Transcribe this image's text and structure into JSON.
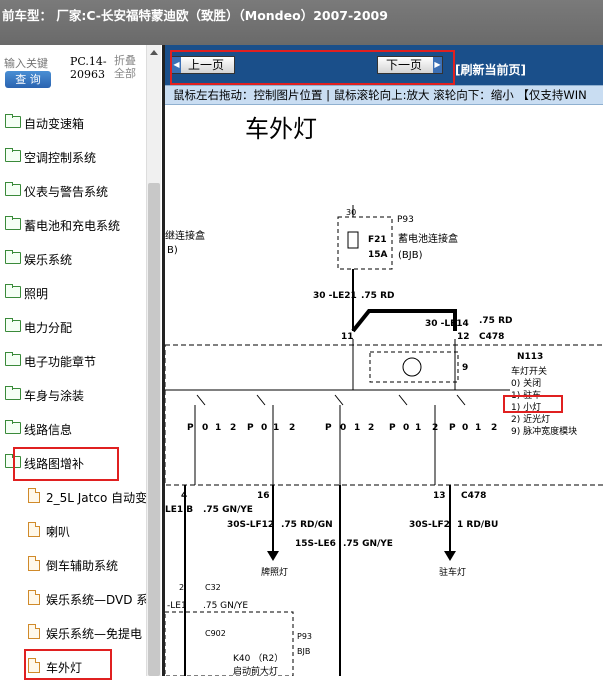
{
  "header": {
    "title": "前车型： 厂家:C-长安福特蒙迪欧（致胜）（Mondeo）2007-2009"
  },
  "search": {
    "placeholder": "输入关键",
    "button": "查 询"
  },
  "pc_code": {
    "line1": "PC.14-",
    "line2": "20963"
  },
  "fold": {
    "line1": "折叠",
    "line2": "全部"
  },
  "tree": {
    "items": [
      {
        "label": "自动变速箱",
        "icon": "folder-icon"
      },
      {
        "label": "空调控制系统",
        "icon": "folder-icon"
      },
      {
        "label": "仪表与警告系统",
        "icon": "folder-icon"
      },
      {
        "label": "蓄电池和充电系统",
        "icon": "folder-icon"
      },
      {
        "label": "娱乐系统",
        "icon": "folder-icon"
      },
      {
        "label": "照明",
        "icon": "folder-icon"
      },
      {
        "label": "电力分配",
        "icon": "folder-icon"
      },
      {
        "label": "电子功能章节",
        "icon": "folder-icon"
      },
      {
        "label": "车身与涂装",
        "icon": "folder-icon"
      },
      {
        "label": "线路信息",
        "icon": "folder-icon"
      },
      {
        "label": "线路图增补",
        "icon": "folder-open-icon"
      },
      {
        "label": "2_5L Jatco 自动变",
        "icon": "file-icon"
      },
      {
        "label": "喇叭",
        "icon": "file-icon"
      },
      {
        "label": "倒车辅助系统",
        "icon": "file-icon"
      },
      {
        "label": "娱乐系统—DVD 系",
        "icon": "file-icon"
      },
      {
        "label": "娱乐系统—免提电",
        "icon": "file-icon"
      },
      {
        "label": "车外灯",
        "icon": "file-icon"
      }
    ]
  },
  "nav": {
    "prev": "上一页",
    "next": "下一页",
    "refresh": "[刷新当前页]"
  },
  "hint": "鼠标左右拖动：控制图片位置 | 鼠标滚轮向上:放大  滚轮向下：缩小 【仅支持WIN",
  "diagram": {
    "title": "车外灯",
    "fuse_box_left": "继连接盒",
    "fuse_box_left2": "B)",
    "p93": "P93",
    "f21": "F21",
    "f21_amp": "15A",
    "battery_box": "蓄电池连接盒",
    "bjb": "(BJB)",
    "pin30": "30",
    "wire_30_le21": "30 -LE21",
    "wire_75rd_1": ".75 RD",
    "wire_30_le14": "30 -LE14",
    "wire_75rd_2": ".75 RD",
    "pin11": "11",
    "pin12": "12",
    "c478": "C478",
    "n113": "N113",
    "switch_title": "车灯开关",
    "sw0": "0) 关闭",
    "sw1": "1) 驻车",
    "sw2": "1) 小灯",
    "sw3": "2) 近光灯",
    "sw4": "9) 脉冲宽度模块",
    "pin9": "9",
    "pin4": "4",
    "pin16": "16",
    "pin13": "13",
    "c478b": "C478",
    "le1b": "LE1 B",
    "gnye1": ".75 GN/YE",
    "s30_lf12": "30S-LF12",
    "rdgn": ".75 RD/GN",
    "s15_le6": "15S-LE6",
    "gnye2": ".75 GN/YE",
    "s30_lf2": "30S-LF2",
    "rdbu": "1 RD/BU",
    "plate_light": "牌照灯",
    "park_light": "驻车灯",
    "pin2": "2",
    "c32": "C32",
    "le1": "-LE1",
    "gnye3": ".75 GN/YE",
    "c902": "C902",
    "k40": "K40 （R2）",
    "k40b": "启动前大灯",
    "p93b": "P93",
    "bjb2": "BJB"
  }
}
